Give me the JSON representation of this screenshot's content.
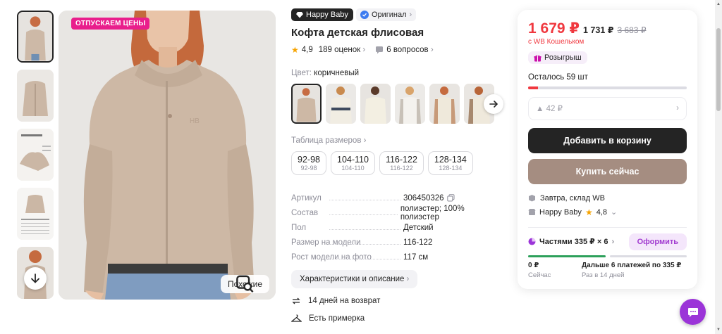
{
  "gallery": {
    "promo_badge": "ОТПУСКАЕМ ЦЕНЫ",
    "similar_label": "Похожие",
    "thumb_count": 5
  },
  "product": {
    "brand_tag": "Happy Baby",
    "original_tag": "Оригинал",
    "title": "Кофта детская флисовая",
    "rating": "4,9",
    "reviews": "189 оценок",
    "questions": "6 вопросов",
    "color_label": "Цвет:",
    "color_value": "коричневый",
    "size_table_link": "Таблица размеров",
    "sizes": [
      {
        "main": "92-98",
        "sub": "92-98"
      },
      {
        "main": "104-110",
        "sub": "104-110"
      },
      {
        "main": "116-122",
        "sub": "116-122"
      },
      {
        "main": "128-134",
        "sub": "128-134"
      }
    ],
    "specs": [
      {
        "k": "Артикул",
        "v": "306450326"
      },
      {
        "k": "Состав",
        "v": "полиэстер; 100% полиэстер"
      },
      {
        "k": "Пол",
        "v": "Детский"
      },
      {
        "k": "Размер на модели",
        "v": "116-122"
      },
      {
        "k": "Рост модели на фото",
        "v": "117 см"
      }
    ],
    "chars_button": "Характеристики и описание",
    "return_policy": "14 дней на возврат",
    "fitting": "Есть примерка"
  },
  "buy_panel": {
    "price_main": "1 679 ₽",
    "price_regular": "1 731 ₽",
    "price_old": "3 683 ₽",
    "wallet_note": "с WB Кошельком",
    "raffle": "Розыгрыш",
    "stock_left": "Осталось 59 шт",
    "stock_fill_fraction": 0.06,
    "bonus": "▲ 42 ₽",
    "add_to_cart": "Добавить в корзину",
    "buy_now": "Купить сейчас",
    "delivery": "Завтра, склад WB",
    "seller_name": "Happy Baby",
    "seller_rating": "4,8",
    "installments": "Частями 335 ₽ × 6",
    "order_button": "Оформить",
    "pay_now_amount": "0 ₽",
    "pay_now_label": "Сейчас",
    "pay_later_text": "Дальше 6 платежей по 335 ₽",
    "pay_later_date": "Раз в 14 дней"
  },
  "colors": {
    "accent_red": "#f0383f",
    "brand_purple": "#9b34d8",
    "buy_button": "#a58d81",
    "cart_button": "#242424"
  }
}
